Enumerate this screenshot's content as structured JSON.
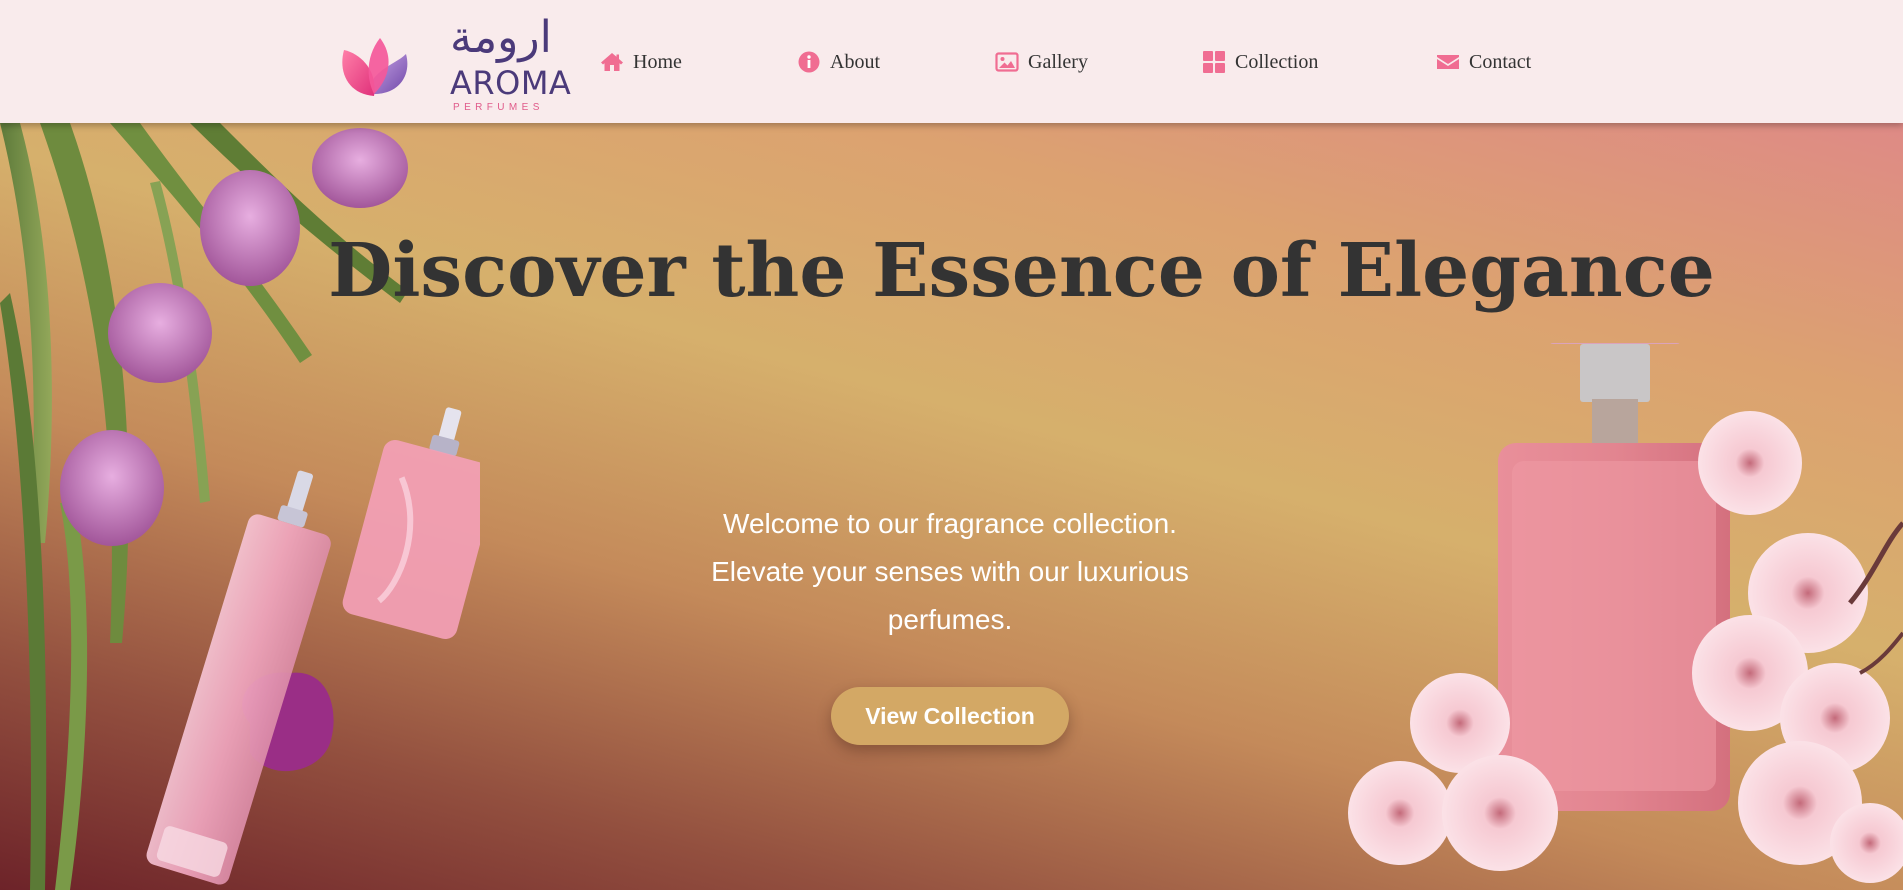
{
  "brand": {
    "arabic_name": "ارومة",
    "name": "AROMA",
    "tagline": "PERFUMES"
  },
  "nav": {
    "items": [
      {
        "label": "Home",
        "icon": "home-icon"
      },
      {
        "label": "About",
        "icon": "info-icon"
      },
      {
        "label": "Gallery",
        "icon": "image-icon"
      },
      {
        "label": "Collection",
        "icon": "grid-icon"
      },
      {
        "label": "Contact",
        "icon": "envelope-icon"
      }
    ]
  },
  "hero": {
    "title": "Discover the Essence of Elegance",
    "text": "Welcome to our fragrance collection. Elevate your senses with our luxurious perfumes.",
    "button_label": "View Collection"
  },
  "colors": {
    "header_bg": "#f9ebec",
    "accent_pink": "#f06d92",
    "button": "#d3a865",
    "title": "#333333",
    "brand_purple": "#4b3a7a"
  }
}
